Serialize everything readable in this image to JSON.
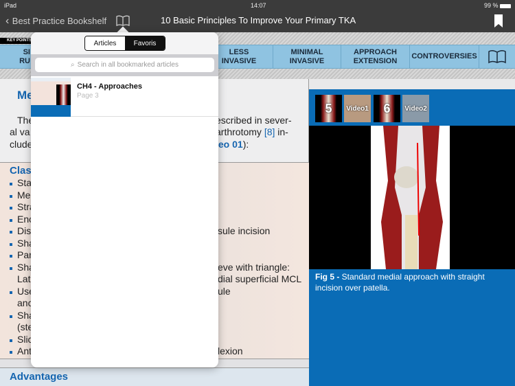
{
  "status": {
    "device": "iPad",
    "time": "14:07",
    "battery": "99 %"
  },
  "nav": {
    "back": "Best Practice Bookshelf",
    "title": "10 Basic Principles To Improve Your Primary TKA"
  },
  "key_points": "KEY POINTS",
  "menu": [
    {
      "label": "SI\nRU"
    },
    {
      "label": "LESS\nINVASIVE"
    },
    {
      "label": "MINIMAL\nINVASIVE"
    },
    {
      "label": "APPROACH\nEXTENSION"
    },
    {
      "label": "CONTROVERSIES"
    }
  ],
  "content": {
    "heading": "Me",
    "para": [
      "The",
      "escribed in sever-",
      "al va",
      "arthrotomy ",
      "[8]",
      " in-",
      "clude",
      "leo 01",
      "):"
    ],
    "class_heading": "Clas",
    "bullets_left": [
      "Sta",
      "Me",
      "Stra",
      "Enc",
      "Dis",
      "Sha",
      "Par",
      "Sha",
      "Lat",
      "Use",
      "anc",
      "Sha",
      "(ste",
      "Slic",
      "Ant"
    ],
    "bullets_right": [
      "",
      "",
      "",
      "",
      "sule incision",
      "",
      "",
      "eve with triangle:",
      "dial superficial MCL",
      "ule",
      "",
      "",
      "",
      "",
      "lexion"
    ],
    "advantages": "Advantages"
  },
  "figure": {
    "thumbs": [
      "5",
      "Video1",
      "6",
      "Video2"
    ],
    "caption_bold": "Fig 5 - ",
    "caption": "Standard medial approach with straight incision over patella."
  },
  "popover": {
    "tabs": [
      "Articles",
      "Favoris"
    ],
    "search_placeholder": "Search in all bookmarked articles",
    "items": [
      {
        "title": "CH4 - Approaches",
        "subtitle": "Page 3"
      }
    ]
  }
}
